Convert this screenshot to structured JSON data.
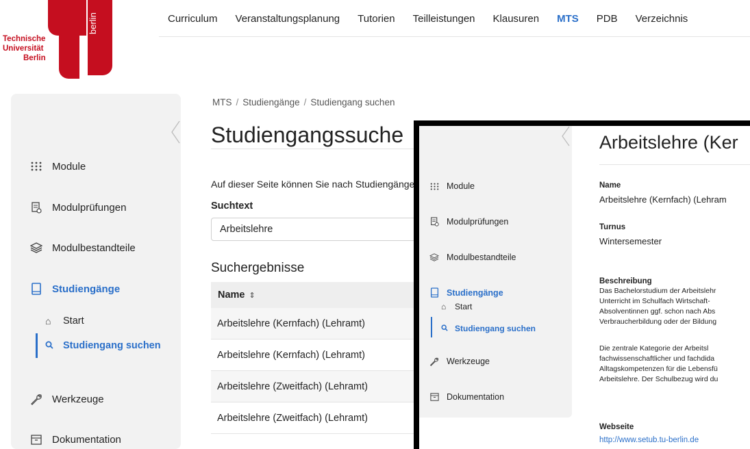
{
  "logo": {
    "line1": "Technische",
    "line2": "Universität",
    "line3": "Berlin",
    "vertical": "berlin",
    "brand_color": "#c50e1f"
  },
  "topnav": {
    "items": [
      "Curriculum",
      "Veranstaltungsplanung",
      "Tutorien",
      "Teilleistungen",
      "Klausuren",
      "MTS",
      "PDB",
      "Verzeichnis"
    ],
    "active": "MTS",
    "accent_color": "#2a6fc9"
  },
  "sidebar": {
    "items": [
      {
        "label": "Module",
        "icon": "grid-dots-icon"
      },
      {
        "label": "Modulprüfungen",
        "icon": "exam-doc-icon"
      },
      {
        "label": "Modulbestandteile",
        "icon": "layers-icon"
      },
      {
        "label": "Studiengänge",
        "icon": "book-icon",
        "active": true
      },
      {
        "label": "Werkzeuge",
        "icon": "wrench-icon"
      },
      {
        "label": "Dokumentation",
        "icon": "archive-box-icon"
      }
    ],
    "sub_items": [
      {
        "label": "Start",
        "icon": "home-icon"
      },
      {
        "label": "Studiengang suchen",
        "icon": "search-icon",
        "active": true
      }
    ]
  },
  "main": {
    "breadcrumb": [
      "MTS",
      "Studiengänge",
      "Studiengang suchen"
    ],
    "title": "Studiengangssuche",
    "intro": "Auf dieser Seite können Sie nach Studiengänge",
    "search_label": "Suchtext",
    "search_value": "Arbeitslehre",
    "results_heading": "Suchergebnisse",
    "table_header": "Name",
    "results": [
      "Arbeitslehre (Kernfach) (Lehramt)",
      "Arbeitslehre (Kernfach) (Lehramt)",
      "Arbeitslehre (Zweitfach) (Lehramt)",
      "Arbeitslehre (Zweitfach) (Lehramt)"
    ]
  },
  "detail": {
    "title": "Arbeitslehre (Ker",
    "name_label": "Name",
    "name_value": "Arbeitslehre (Kernfach) (Lehram",
    "turnus_label": "Turnus",
    "turnus_value": "Wintersemester",
    "beschreibung_label": "Beschreibung",
    "para1": [
      "Das Bachelorstudium der Arbeitslehr",
      "Unterricht im Schulfach Wirtschaft-",
      "Absolventinnen ggf. schon nach Abs",
      "Verbraucherbildung oder der Bildung"
    ],
    "para2": [
      "Die zentrale Kategorie der Arbeitsl",
      "fachwissenschaftlicher und fachdida",
      "Alltagskompetenzen für die Lebensfü",
      "Arbeitslehre. Der Schulbezug wird du"
    ],
    "webseite_label": "Webseite",
    "webseite_url": "http://www.setub.tu-berlin.de"
  }
}
